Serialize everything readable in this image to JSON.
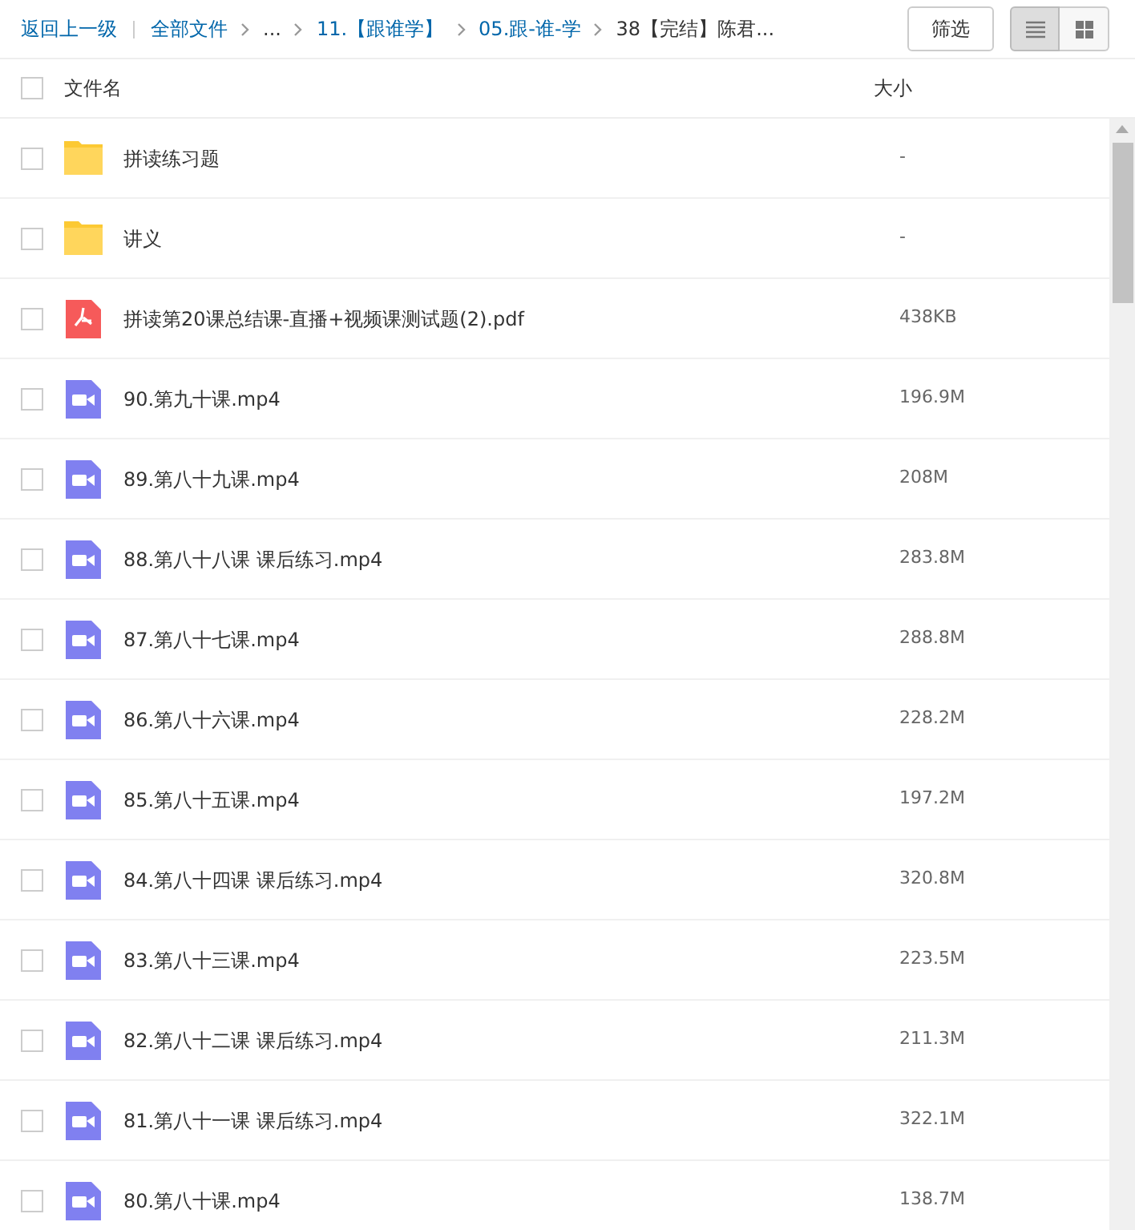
{
  "breadcrumb": {
    "back": "返回上一级",
    "items": [
      {
        "label": "全部文件",
        "link": true
      },
      {
        "label": "...",
        "link": false
      },
      {
        "label": "11.【跟谁学】",
        "link": true
      },
      {
        "label": "05.跟-谁-学",
        "link": true
      },
      {
        "label": "38【完结】陈君...",
        "link": false
      }
    ]
  },
  "filter_button": "筛选",
  "view_modes": [
    {
      "kind": "list",
      "selected": true
    },
    {
      "kind": "grid",
      "selected": false
    }
  ],
  "columns": {
    "select_all_checked": false,
    "name": "文件名",
    "size": "大小"
  },
  "files": [
    {
      "kind": "folder",
      "name": "拼读练习题",
      "size": "-",
      "checked": false
    },
    {
      "kind": "folder",
      "name": "讲义",
      "size": "-",
      "checked": false
    },
    {
      "kind": "pdf",
      "name": "拼读第20课总结课-直播+视频课测试题(2).pdf",
      "size": "438KB",
      "checked": false
    },
    {
      "kind": "video",
      "name": "90.第九十课.mp4",
      "size": "196.9M",
      "checked": false
    },
    {
      "kind": "video",
      "name": "89.第八十九课.mp4",
      "size": "208M",
      "checked": false
    },
    {
      "kind": "video",
      "name": "88.第八十八课 课后练习.mp4",
      "size": "283.8M",
      "checked": false
    },
    {
      "kind": "video",
      "name": "87.第八十七课.mp4",
      "size": "288.8M",
      "checked": false
    },
    {
      "kind": "video",
      "name": "86.第八十六课.mp4",
      "size": "228.2M",
      "checked": false
    },
    {
      "kind": "video",
      "name": "85.第八十五课.mp4",
      "size": "197.2M",
      "checked": false
    },
    {
      "kind": "video",
      "name": "84.第八十四课 课后练习.mp4",
      "size": "320.8M",
      "checked": false
    },
    {
      "kind": "video",
      "name": "83.第八十三课.mp4",
      "size": "223.5M",
      "checked": false
    },
    {
      "kind": "video",
      "name": "82.第八十二课 课后练习.mp4",
      "size": "211.3M",
      "checked": false
    },
    {
      "kind": "video",
      "name": "81.第八十一课 课后练习.mp4",
      "size": "322.1M",
      "checked": false
    },
    {
      "kind": "video",
      "name": "80.第八十课.mp4",
      "size": "138.7M",
      "checked": false
    }
  ]
}
